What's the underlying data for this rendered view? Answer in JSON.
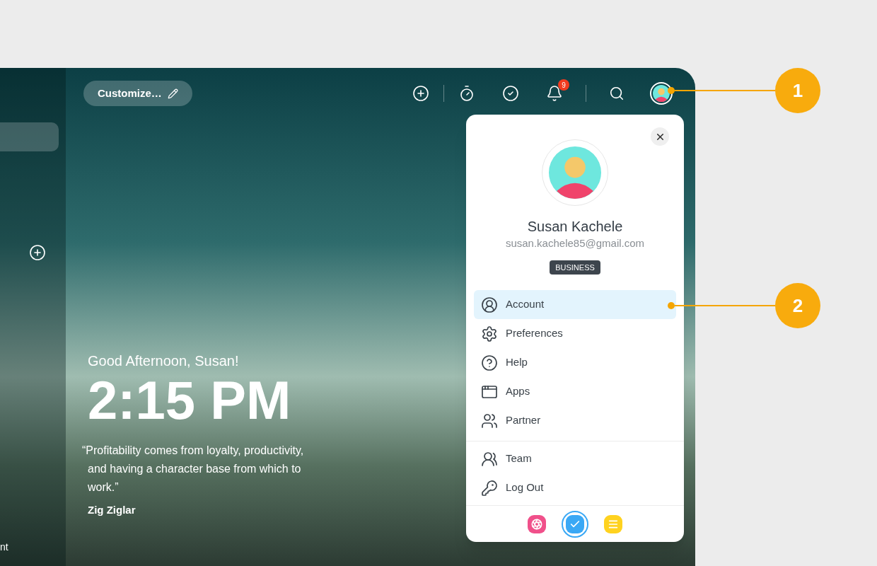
{
  "sidebar": {
    "footer_text": "nt"
  },
  "toolbar": {
    "customize_label": "Customize…",
    "notification_count": "9"
  },
  "greeting": "Good Afternoon, Susan!",
  "time": "2:15 PM",
  "quote": "“Profitability comes from loyalty, productivity, and having a character base from which to work.”",
  "author": "Zig Ziglar",
  "profile": {
    "name": "Susan Kachele",
    "email": "susan.kachele85@gmail.com",
    "plan": "BUSINESS"
  },
  "menu_groups": [
    [
      {
        "label": "Account",
        "selected": true
      },
      {
        "label": "Preferences",
        "selected": false
      },
      {
        "label": "Help",
        "selected": false
      },
      {
        "label": "Apps",
        "selected": false
      },
      {
        "label": "Partner",
        "selected": false
      }
    ],
    [
      {
        "label": "Team",
        "selected": false
      },
      {
        "label": "Log Out",
        "selected": false
      }
    ]
  ],
  "apps": [
    {
      "color": "#f0508a",
      "selected": false
    },
    {
      "color": "#3aa8f5",
      "selected": true
    },
    {
      "color": "#ffd21f",
      "selected": false
    }
  ],
  "callouts": [
    {
      "number": "1"
    },
    {
      "number": "2"
    }
  ]
}
